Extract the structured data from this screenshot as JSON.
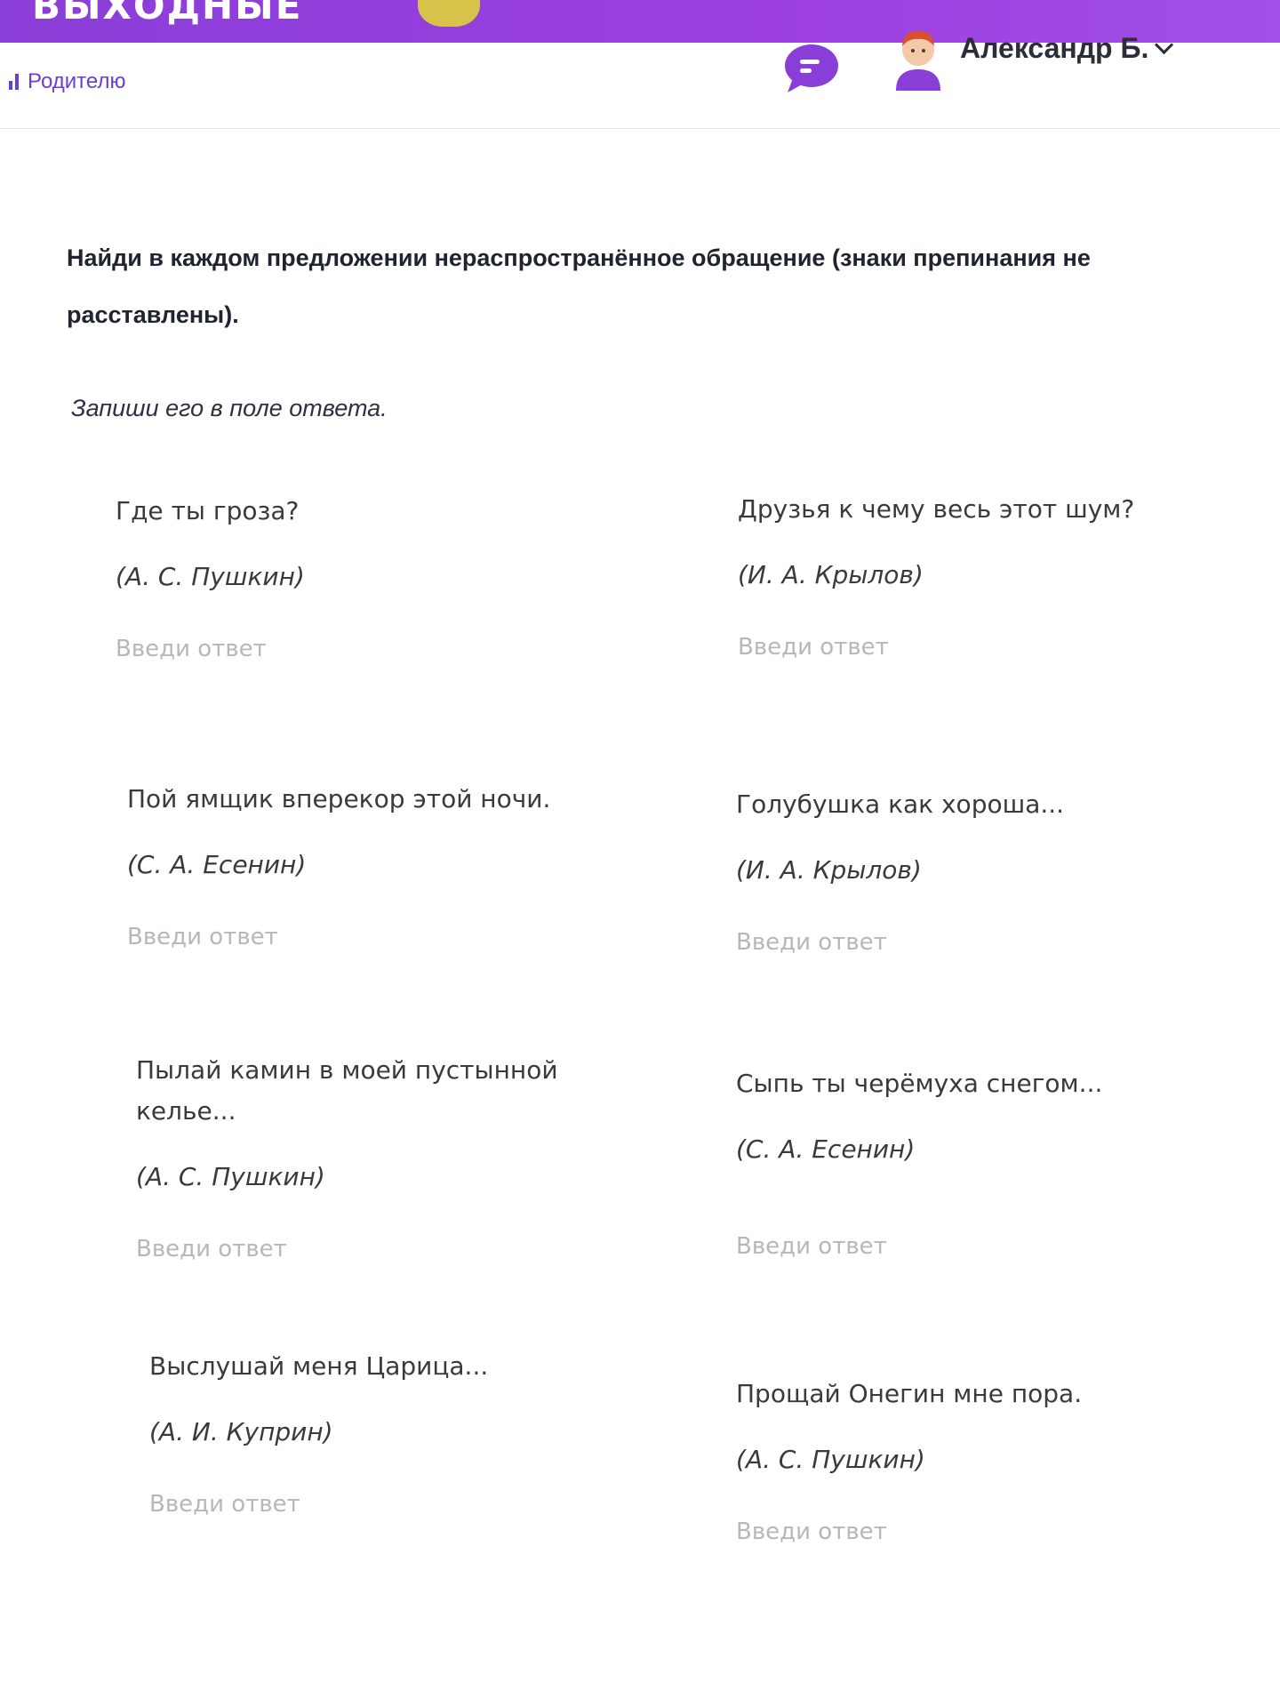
{
  "banner": {
    "text": "ВЫХОДНЫЕ"
  },
  "header": {
    "parent_link": "Родителю",
    "user_name": "Александр Б."
  },
  "task": {
    "title": "Найди в каждом предложении нераспространённое обращение (знаки препинания не расставлены).",
    "instruction": "Запиши его в поле ответа."
  },
  "items": [
    {
      "sentence": "Где ты гроза?",
      "author": "(А. С. Пушкин)",
      "placeholder": "Введи ответ",
      "value": ""
    },
    {
      "sentence": "Друзья к чему весь этот шум?",
      "author": "(И. А. Крылов)",
      "placeholder": "Введи ответ",
      "value": ""
    },
    {
      "sentence": "Пой ямщик вперекор этой ночи.",
      "author": "(С. А. Есенин)",
      "placeholder": "Введи ответ",
      "value": ""
    },
    {
      "sentence": "Голубушка как хороша...",
      "author": "(И. А. Крылов)",
      "placeholder": "Введи ответ",
      "value": ""
    },
    {
      "sentence": "Пылай камин в моей пустынной келье...",
      "author": "(А. С. Пушкин)",
      "placeholder": "Введи ответ",
      "value": ""
    },
    {
      "sentence": "Сыпь ты черёмуха снегом...",
      "author": "(С. А. Есенин)",
      "placeholder": "Введи ответ",
      "value": ""
    },
    {
      "sentence": "Выслушай меня Царица...",
      "author": "(А. И. Куприн)",
      "placeholder": "Введи ответ",
      "value": ""
    },
    {
      "sentence": "Прощай Онегин мне пора.",
      "author": "(А. С. Пушкин)",
      "placeholder": "Введи ответ",
      "value": ""
    }
  ],
  "colors": {
    "accent": "#8a3ed8",
    "link": "#6b3fd0",
    "placeholder": "#b7b7b7"
  }
}
